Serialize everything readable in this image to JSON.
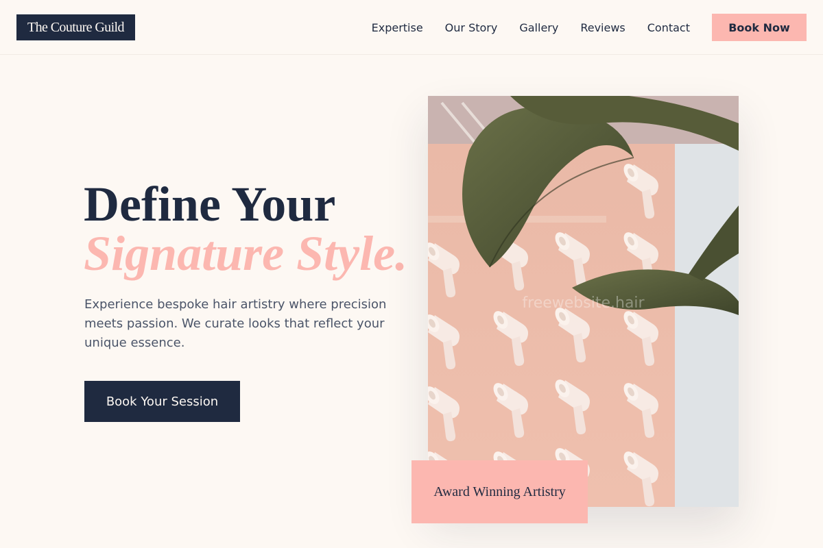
{
  "brand": {
    "name": "The Couture Guild"
  },
  "nav": {
    "links": [
      "Expertise",
      "Our Story",
      "Gallery",
      "Reviews",
      "Contact"
    ],
    "cta_label": "Book Now"
  },
  "hero": {
    "title_line1": "Define Your",
    "title_line2": "Signature Style.",
    "description": "Experience bespoke hair artistry where precision meets passion. We curate looks that reflect your unique essence.",
    "cta_label": "Book Your Session",
    "image_watermark": "freewebsite.hair",
    "award_label": "Award Winning Artistry"
  },
  "colors": {
    "navy": "#1f2a40",
    "blush": "#fcb7b0",
    "cream": "#fdf8f3"
  }
}
